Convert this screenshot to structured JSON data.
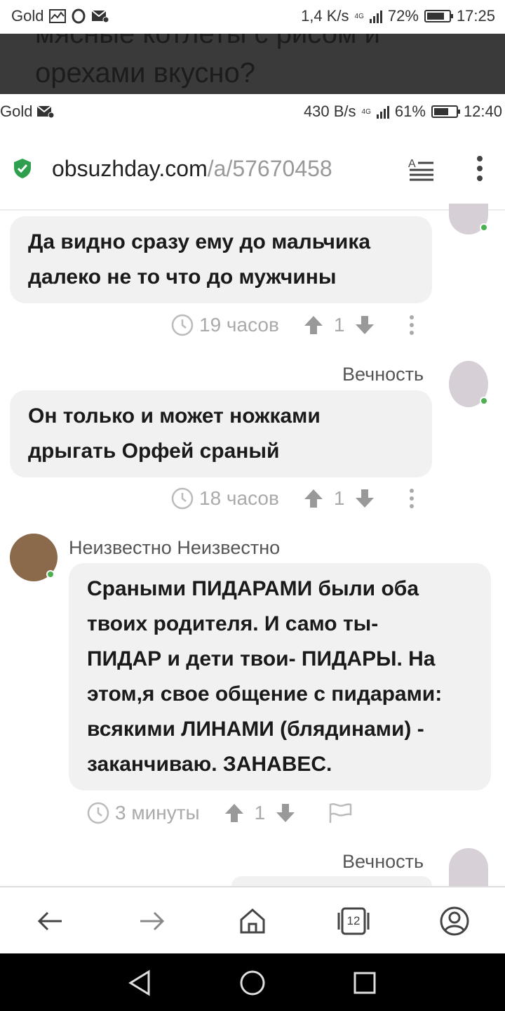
{
  "outer_status": {
    "carrier": "Gold",
    "speed": "1,4 K/s",
    "network": "4G",
    "battery": "72%",
    "time": "17:25"
  },
  "article_header": {
    "line1": "мясные котлеты с рисом и",
    "line2": "орехами вкусно?"
  },
  "inner_status": {
    "carrier": "Gold",
    "speed": "430 B/s",
    "network": "4G",
    "battery": "61%",
    "time": "12:40"
  },
  "url_bar": {
    "domain": "obsuzhday.com",
    "path": "/a/57670458"
  },
  "comments": [
    {
      "author": "",
      "text_lines": [
        "Да видно сразу ему до мальчика",
        "далеко не то что до мужчины"
      ],
      "time": "19 часов",
      "votes": "1"
    },
    {
      "author": "Вечность",
      "text_lines": [
        "Он только и может ножками",
        "дрыгать Орфей сраный"
      ],
      "time": "18 часов",
      "votes": "1"
    },
    {
      "author": "Неизвестно Неизвестно",
      "text_lines": [
        "Сраными ПИДАРАМИ были оба",
        "твоих родителя. И само ты-",
        "ПИДАР и дети твои- ПИДАРЫ. На",
        "этом,я свое общение с пидарами:",
        "всякими ЛИНАМИ (блядинами) -",
        "заканчиваю. ЗАНАВЕС."
      ],
      "time": "3 минуты",
      "votes": "1"
    },
    {
      "author": "Вечность"
    }
  ],
  "tabs_count": "12",
  "colors": {
    "online": "#4caf50",
    "bubble": "#f1f1f1",
    "shield": "#2e9e4f"
  }
}
